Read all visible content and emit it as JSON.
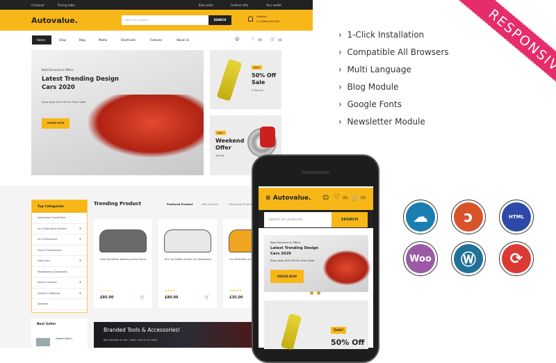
{
  "desktop": {
    "topbar": {
      "links": [
        "Checkout",
        "Pricing table"
      ],
      "promos": [
        "Bulk order",
        "Festival offer",
        "Your wallet"
      ]
    },
    "header": {
      "logo": "Autovalue.",
      "search_placeholder": "Search for products...",
      "search_button": "SEARCH",
      "helpline_label": "Helpline:",
      "helpline_number": "(+1)2080-459-528"
    },
    "nav": {
      "items": [
        "Home",
        "Shop",
        "Blog",
        "Media",
        "ShortCode",
        "Features",
        "About Us"
      ],
      "wishlist_count": "(0)",
      "cart_count": "(0)"
    },
    "hero": {
      "kicker": "Best Discount & Offers",
      "title_line1": "Latest Trending Design",
      "title_line2": "Cars 2020",
      "subtitle": "Save Upto 30% Off On First Order",
      "button": "ORDER NOW"
    },
    "promo1": {
      "badge": "Sale!",
      "title_line1": "50% Off",
      "title_line2": "Sale",
      "tag": "# Popular"
    },
    "promo2": {
      "badge": "Sale!",
      "title_line1": "Weekend",
      "title_line2": "Offer",
      "tag": "#Break"
    },
    "categories": {
      "title": "Top Categories",
      "items": [
        {
          "label": "Automotive Turned Parts",
          "plus": ""
        },
        {
          "label": "Car & Bike Decal Stickers",
          "plus": "+"
        },
        {
          "label": "Car & Electronics",
          "plus": "+"
        },
        {
          "label": "Drive & Transmission",
          "plus": ""
        },
        {
          "label": "Glass Care",
          "plus": "+"
        },
        {
          "label": "Headphones & Earphones",
          "plus": ""
        },
        {
          "label": "Interior Cleaning",
          "plus": "+"
        },
        {
          "label": "Inverter & Batteries",
          "plus": "+"
        },
        {
          "label": "Speakers",
          "plus": ""
        }
      ]
    },
    "trending": {
      "title": "Trending Product",
      "tabs": [
        "Featured Product",
        "New Arrivals",
        "Bestseller Products"
      ],
      "products": [
        {
          "name": "Auto Microfiber Washing Hand Glove",
          "price": "£85.00",
          "rating": 0
        },
        {
          "name": "ELV Car Mobile Holder For Dashboard",
          "price": "£80.00",
          "rating": 4
        },
        {
          "name": "Car Bluetooth Audio Receiver",
          "price": "£35.00",
          "rating": 5
        }
      ]
    },
    "best_seller": {
      "title": "Best Seller",
      "item": "Generic Bum..."
    },
    "banner": {
      "title": "Branded Tools & Accessories!",
      "subtitle": "Big collection of new - stock. Only on our store."
    }
  },
  "mobile": {
    "logo": "Autovalue.",
    "wishlist_count": "(0)",
    "cart_count": "(0)",
    "search_placeholder": "Search for products...",
    "search_button": "SEARCH",
    "hero": {
      "kicker": "Best Discount & Offers",
      "title_line1": "Latest Trending Design",
      "title_line2": "Cars 2020",
      "subtitle": "Save Upto 30% Off On First Order",
      "button": "ORDER NOW"
    },
    "promo": {
      "badge": "Sale!",
      "title": "50% Off"
    }
  },
  "features": [
    "1-Click Installation",
    "Compatible All Browsers",
    "Multi Language",
    "Blog Module",
    "Google Fonts",
    "Newsletter Module"
  ],
  "ribbon": "RESPONSIVE",
  "tech_icons": [
    {
      "name": "cloud-icon",
      "color": "#1a7fb0"
    },
    {
      "name": "opencart-icon",
      "color": "#d9532a"
    },
    {
      "name": "html5-icon",
      "color": "#2e4aa8",
      "label": "HTML"
    },
    {
      "name": "woocommerce-icon",
      "color": "#9b5aa5",
      "label": "Woo"
    },
    {
      "name": "wordpress-icon",
      "color": "#207196"
    },
    {
      "name": "refresh-icon",
      "color": "#db3a34"
    }
  ],
  "colors": {
    "accent": "#f7b718",
    "ribbon": "#e62c6b",
    "dark": "#222222"
  }
}
